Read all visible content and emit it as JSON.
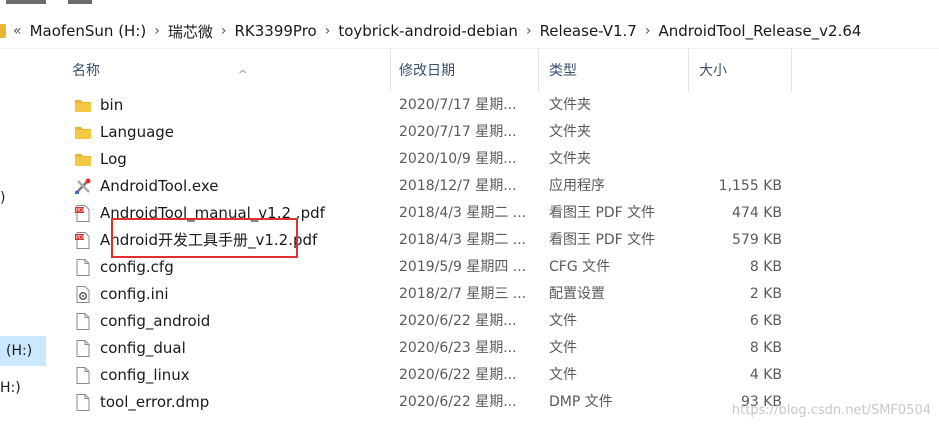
{
  "address": {
    "overflow_glyph": "«",
    "crumbs": [
      "MaofenSun (H:)",
      "瑞芯微",
      "RK3399Pro",
      "toybrick-android-debian",
      "Release-V1.7",
      "AndroidTool_Release_v2.64"
    ]
  },
  "nav": {
    "items": [
      {
        "label": ")",
        "selected": false
      },
      {
        "label": "(H:)",
        "selected": true
      },
      {
        "label": "H:)",
        "selected": false
      }
    ]
  },
  "columns": {
    "name": "名称",
    "date": "修改日期",
    "type": "类型",
    "size": "大小"
  },
  "files": [
    {
      "name": "bin",
      "date": "2020/7/17 星期...",
      "type": "文件夹",
      "size": "",
      "icon": "folder-icon"
    },
    {
      "name": "Language",
      "date": "2020/7/17 星期...",
      "type": "文件夹",
      "size": "",
      "icon": "folder-icon"
    },
    {
      "name": "Log",
      "date": "2020/10/9 星期...",
      "type": "文件夹",
      "size": "",
      "icon": "folder-icon"
    },
    {
      "name": "AndroidTool.exe",
      "date": "2018/12/7 星期...",
      "type": "应用程序",
      "size": "1,155 KB",
      "icon": "tools-icon"
    },
    {
      "name": "AndroidTool_manual_v1.2 .pdf",
      "date": "2018/4/3 星期二 ...",
      "type": "看图王 PDF 文件",
      "size": "474 KB",
      "icon": "pdf-icon"
    },
    {
      "name": "Android开发工具手册_v1.2.pdf",
      "date": "2018/4/3 星期二 ...",
      "type": "看图王 PDF 文件",
      "size": "579 KB",
      "icon": "pdf-icon"
    },
    {
      "name": "config.cfg",
      "date": "2019/5/9 星期四 ...",
      "type": "CFG 文件",
      "size": "8 KB",
      "icon": "file-icon"
    },
    {
      "name": "config.ini",
      "date": "2018/2/7 星期三 ...",
      "type": "配置设置",
      "size": "2 KB",
      "icon": "settings-file-icon"
    },
    {
      "name": "config_android",
      "date": "2020/6/22 星期...",
      "type": "文件",
      "size": "6 KB",
      "icon": "file-icon"
    },
    {
      "name": "config_dual",
      "date": "2020/6/23 星期...",
      "type": "文件",
      "size": "8 KB",
      "icon": "file-icon"
    },
    {
      "name": "config_linux",
      "date": "2020/6/22 星期...",
      "type": "文件",
      "size": "4 KB",
      "icon": "file-icon"
    },
    {
      "name": "tool_error.dmp",
      "date": "2020/6/22 星期...",
      "type": "DMP 文件",
      "size": "93 KB",
      "icon": "file-icon"
    }
  ],
  "highlight_file": "AndroidTool.exe",
  "watermark": "https://blog.csdn.net/SMF0504",
  "colors": {
    "folder": "#e8b632",
    "selection": "#cce8ff",
    "highlight_border": "#e0322d",
    "header_text": "#3c4f6b"
  }
}
